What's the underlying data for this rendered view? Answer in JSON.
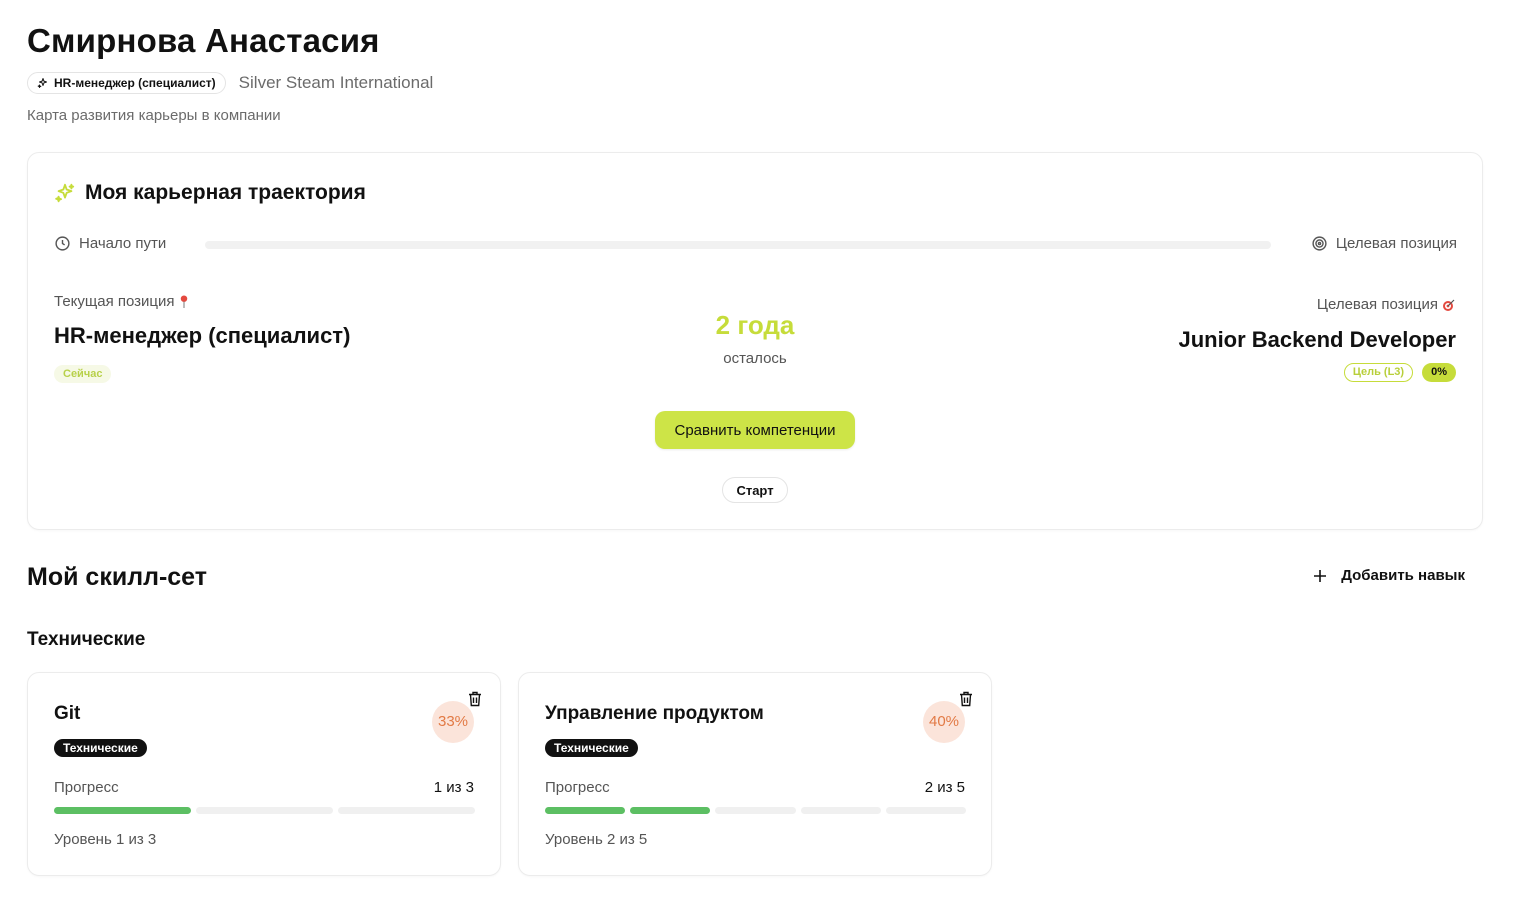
{
  "profile": {
    "name": "Смирнова Анастасия",
    "role": "HR-менеджер (специалист)",
    "company": "Silver Steam International",
    "subtitle": "Карта развития карьеры в компании"
  },
  "trajectory": {
    "title": "Моя карьерная траектория",
    "start_label": "Начало пути",
    "end_label": "Целевая позиция",
    "progress": 0,
    "current_label": "Текущая позиция",
    "current_title": "HR-менеджер (специалист)",
    "current_badge": "Сейчас",
    "remaining_value": "2 года",
    "remaining_label": "осталось",
    "target_label": "Целевая позиция",
    "target_title": "Junior Backend Developer",
    "target_goal_badge": "Цель (L3)",
    "target_percent": "0%",
    "compare_button": "Сравнить компетенции",
    "start_button": "Старт"
  },
  "skills": {
    "title": "Мой скилл-сет",
    "add_button": "Добавить навык",
    "category": "Технические",
    "items": [
      {
        "name": "Git",
        "tag": "Технические",
        "percent": "33%",
        "progress_label": "Прогресс",
        "progress_count": "1 из 3",
        "level_text": "Уровень 1 из 3",
        "level": 1,
        "levels_total": 3
      },
      {
        "name": "Управление продуктом",
        "tag": "Технические",
        "percent": "40%",
        "progress_label": "Прогресс",
        "progress_count": "2 из 5",
        "level_text": "Уровень 2 из 5",
        "level": 2,
        "levels_total": 5
      }
    ]
  },
  "colors": {
    "accent": "#cde447",
    "accent_text": "#c6dc3a",
    "segment_on": "#5cbf63",
    "segment_off": "#f0f0f0",
    "percent_bg": "#fbe4da",
    "percent_text": "#e27a45"
  },
  "icons": {
    "role": "sparkles-icon",
    "trajectory": "sparkles-icon",
    "start": "clock-icon",
    "end": "target-icon",
    "current": "pin-icon",
    "target": "dart-icon",
    "add": "plus-icon",
    "delete": "trash-icon"
  }
}
